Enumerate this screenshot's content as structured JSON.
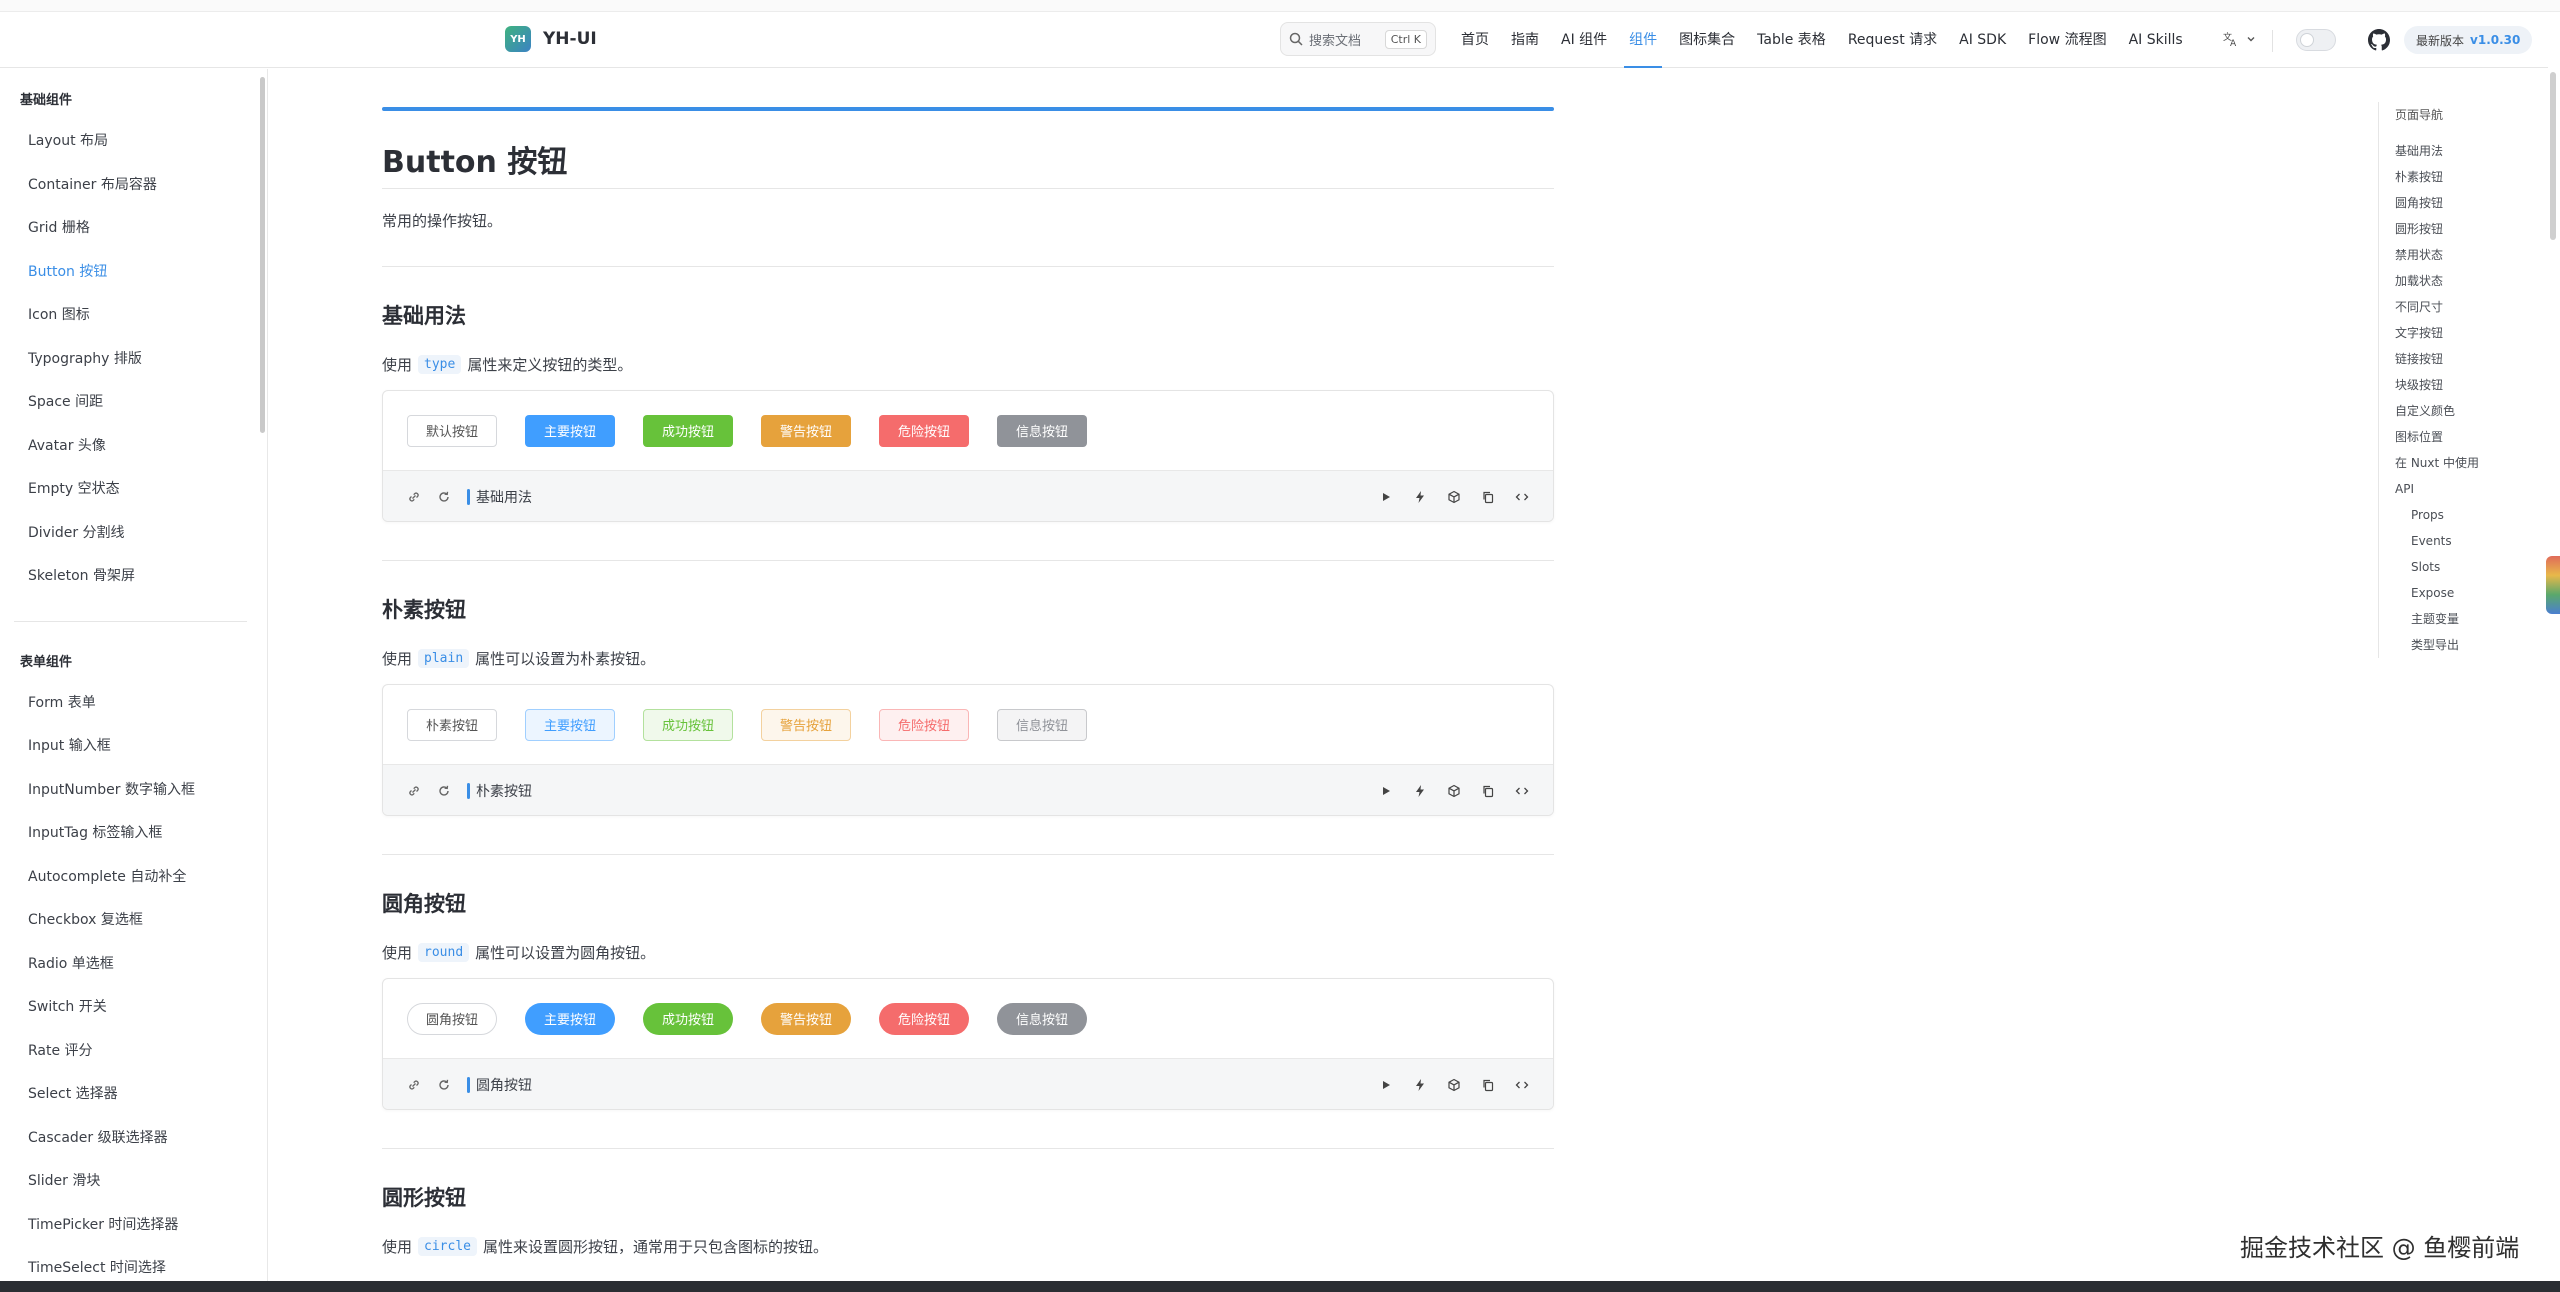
{
  "header": {
    "brand_logo": "YH",
    "brand_name": "YH-UI",
    "search_placeholder": "搜索文档",
    "search_shortcut": "Ctrl K",
    "nav": [
      {
        "label": "首页",
        "active": false
      },
      {
        "label": "指南",
        "active": false
      },
      {
        "label": "AI 组件",
        "active": false
      },
      {
        "label": "组件",
        "active": true
      },
      {
        "label": "图标集合",
        "active": false
      },
      {
        "label": "Table 表格",
        "active": false
      },
      {
        "label": "Request 请求",
        "active": false
      },
      {
        "label": "AI SDK",
        "active": false
      },
      {
        "label": "Flow 流程图",
        "active": false
      },
      {
        "label": "AI Skills",
        "active": false
      }
    ],
    "language_icon": "translate-icon",
    "version_label": "最新版本",
    "version_number": "v1.0.30"
  },
  "sidebar": {
    "groups": [
      {
        "title": "基础组件",
        "items": [
          "Layout 布局",
          "Container 布局容器",
          "Grid 栅格",
          "Button 按钮",
          "Icon 图标",
          "Typography 排版",
          "Space 间距",
          "Avatar 头像",
          "Empty 空状态",
          "Divider 分割线",
          "Skeleton 骨架屏"
        ]
      },
      {
        "title": "表单组件",
        "items": [
          "Form 表单",
          "Input 输入框",
          "InputNumber 数字输入框",
          "InputTag 标签输入框",
          "Autocomplete 自动补全",
          "Checkbox 复选框",
          "Radio 单选框",
          "Switch 开关",
          "Rate 评分",
          "Select 选择器",
          "Cascader 级联选择器",
          "Slider 滑块",
          "TimePicker 时间选择器",
          "TimeSelect 时间选择"
        ]
      }
    ],
    "active_item": "Button 按钮"
  },
  "main": {
    "title": "Button 按钮",
    "description": "常用的操作按钮。",
    "sections": [
      {
        "title": "基础用法",
        "desc_before": "使用",
        "code": "type",
        "desc_after": "属性来定义按钮的类型。",
        "variant": "solid",
        "buttons": [
          "默认按钮",
          "主要按钮",
          "成功按钮",
          "警告按钮",
          "危险按钮",
          "信息按钮"
        ],
        "footer_title": "基础用法"
      },
      {
        "title": "朴素按钮",
        "desc_before": "使用",
        "code": "plain",
        "desc_after": "属性可以设置为朴素按钮。",
        "variant": "plain",
        "buttons": [
          "朴素按钮",
          "主要按钮",
          "成功按钮",
          "警告按钮",
          "危险按钮",
          "信息按钮"
        ],
        "footer_title": "朴素按钮"
      },
      {
        "title": "圆角按钮",
        "desc_before": "使用",
        "code": "round",
        "desc_after": "属性可以设置为圆角按钮。",
        "variant": "round",
        "buttons": [
          "圆角按钮",
          "主要按钮",
          "成功按钮",
          "警告按钮",
          "危险按钮",
          "信息按钮"
        ],
        "footer_title": "圆角按钮"
      },
      {
        "title": "圆形按钮",
        "desc_before": "使用",
        "code": "circle",
        "desc_after": "属性来设置圆形按钮，通常用于只包含图标的按钮。"
      }
    ],
    "footer_icons": [
      "link-icon",
      "refresh-icon",
      "play-icon",
      "bolt-icon",
      "cube-icon",
      "copy-icon",
      "code-icon"
    ]
  },
  "toc": {
    "title": "页面导航",
    "items": [
      {
        "label": "基础用法",
        "sub": false
      },
      {
        "label": "朴素按钮",
        "sub": false
      },
      {
        "label": "圆角按钮",
        "sub": false
      },
      {
        "label": "圆形按钮",
        "sub": false
      },
      {
        "label": "禁用状态",
        "sub": false
      },
      {
        "label": "加载状态",
        "sub": false
      },
      {
        "label": "不同尺寸",
        "sub": false
      },
      {
        "label": "文字按钮",
        "sub": false
      },
      {
        "label": "链接按钮",
        "sub": false
      },
      {
        "label": "块级按钮",
        "sub": false
      },
      {
        "label": "自定义颜色",
        "sub": false
      },
      {
        "label": "图标位置",
        "sub": false
      },
      {
        "label": "在 Nuxt 中使用",
        "sub": false
      },
      {
        "label": "API",
        "sub": false
      },
      {
        "label": "Props",
        "sub": true
      },
      {
        "label": "Events",
        "sub": true
      },
      {
        "label": "Slots",
        "sub": true
      },
      {
        "label": "Expose",
        "sub": true
      },
      {
        "label": "主题变量",
        "sub": true
      },
      {
        "label": "类型导出",
        "sub": true
      }
    ]
  },
  "watermark": "掘金技术社区 @ 鱼樱前端",
  "colors": {
    "accent": "#3a8ee6",
    "primary": "#409eff",
    "success": "#67c23a",
    "warning": "#e6a23c",
    "danger": "#f56c6c",
    "info": "#909399"
  }
}
